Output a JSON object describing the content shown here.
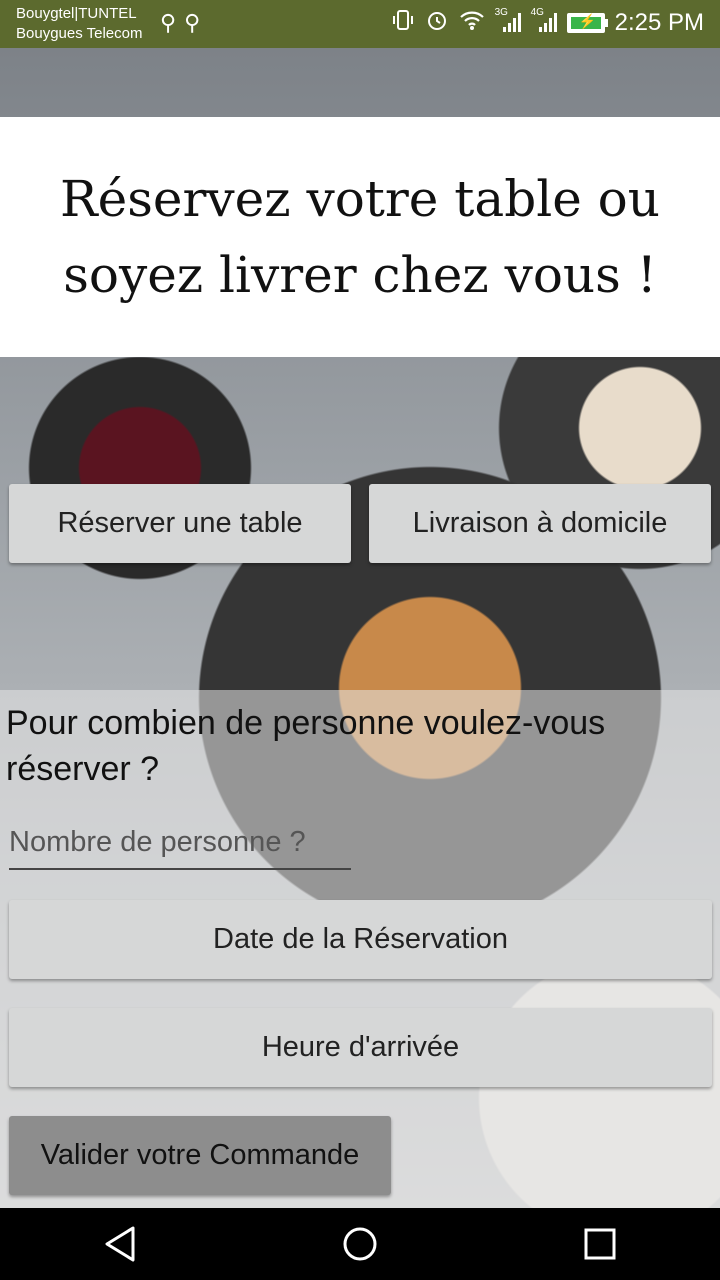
{
  "status_bar": {
    "carrier_line1": "Bouygtel|TUNTEL",
    "carrier_line2": "Bouygues Telecom",
    "network_3g": "3G",
    "network_4g": "4G",
    "time": "2:25 PM"
  },
  "header": {
    "title": "Réservez votre table ou soyez livrer chez vous !"
  },
  "mode_buttons": {
    "reserve_label": "Réserver une table",
    "delivery_label": "Livraison à domicile"
  },
  "form": {
    "question": "Pour combien de personne voulez-vous réserver ?",
    "people_placeholder": "Nombre de personne ?",
    "date_label": "Date de la Réservation",
    "time_label": "Heure d'arrivée",
    "validate_label": "Valider votre Commande"
  },
  "colors": {
    "status_bar": "#5c6a2e",
    "button_bg": "#d6d7d7",
    "validate_bg": "#8d8d8d"
  },
  "icons": [
    "usb-icon",
    "vibrate-icon",
    "alarm-icon",
    "wifi-icon",
    "signal-icon",
    "battery-icon",
    "back-icon",
    "home-icon",
    "recents-icon"
  ]
}
